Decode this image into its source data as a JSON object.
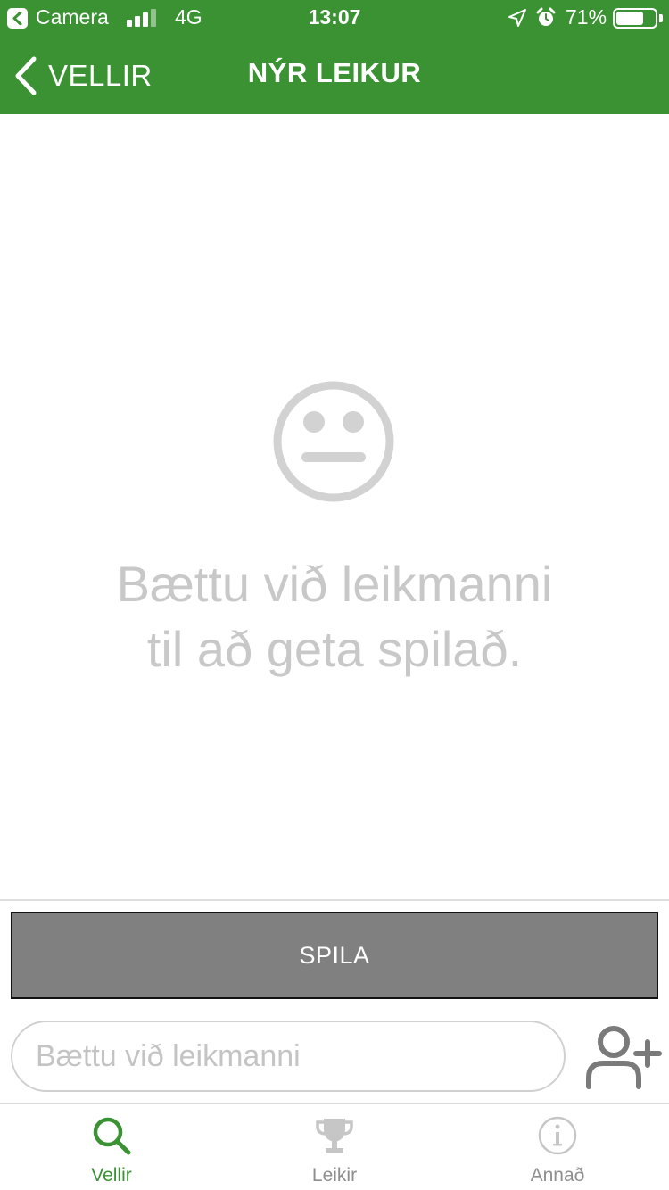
{
  "status_bar": {
    "back_app": "Camera",
    "network": "4G",
    "time": "13:07",
    "battery_percent": "71%",
    "battery_level": 0.71,
    "signal_bars": 3
  },
  "nav": {
    "back_label": "VELLIR",
    "title": "NÝR LEIKUR"
  },
  "empty_state": {
    "icon": "neutral-face-icon",
    "line1": "Bættu við leikmanni",
    "line2": "til að geta spilað."
  },
  "actions": {
    "play_label": "SPILA",
    "player_input_placeholder": "Bættu við leikmanni",
    "player_input_value": "",
    "add_player_icon": "add-user-icon"
  },
  "tabs": [
    {
      "label": "Vellir",
      "icon": "search-icon",
      "active": true
    },
    {
      "label": "Leikir",
      "icon": "trophy-icon",
      "active": false
    },
    {
      "label": "Annað",
      "icon": "info-icon",
      "active": false
    }
  ],
  "colors": {
    "brand_green": "#3a9233",
    "play_button_bg": "#808080",
    "empty_text": "#c8c8c8",
    "inactive_icon": "#c6c6c6"
  }
}
